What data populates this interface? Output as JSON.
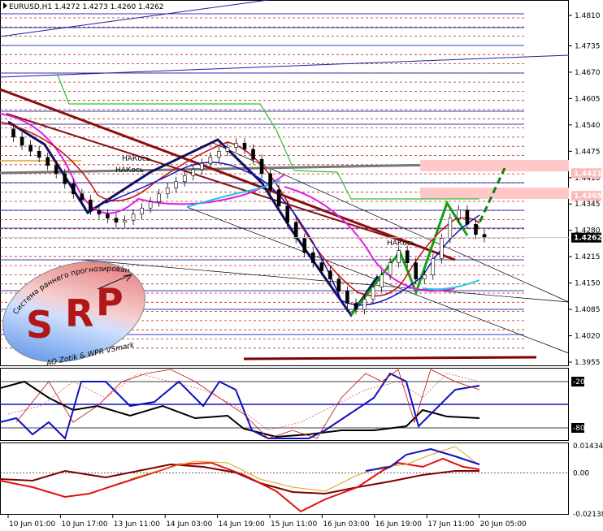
{
  "window": {
    "title": "EURUSD,H1  1.4272 1.4273 1.4260 1.4262"
  },
  "logo": {
    "arc_text": "Система раннего прогнозирования",
    "letters": [
      "S",
      "R",
      "P"
    ],
    "author": "AO Zotik & WPR VSmark"
  },
  "chart_data": [
    {
      "type": "line",
      "name": "price",
      "yticks": [
        "1.4810",
        "1.4735",
        "1.4670",
        "1.4605",
        "1.4540",
        "1.4475",
        "1.4410",
        "1.4345",
        "1.4280",
        "1.4215",
        "1.4150",
        "1.4085",
        "1.4020",
        "1.3955"
      ],
      "xticks": [
        "10 Jun 01:00",
        "10 Jun 17:00",
        "13 Jun 11:00",
        "14 Jun 03:00",
        "14 Jun 19:00",
        "15 Jun 11:00",
        "16 Jun 03:00",
        "16 Jun 19:00",
        "17 Jun 11:00",
        "20 Jun 05:00"
      ],
      "ylim": [
        1.3955,
        1.481
      ],
      "price_labels": [
        {
          "value": "1.4421",
          "color": "#ffb8b8"
        },
        {
          "value": "1.4365",
          "color": "#ffb8b8"
        },
        {
          "value": "1.4262",
          "color": "#000000"
        }
      ],
      "annotations": [
        "НАКось",
        "НАКось",
        "НАКось"
      ],
      "close": [
        1.453,
        1.451,
        1.449,
        1.4475,
        1.446,
        1.444,
        1.442,
        1.4395,
        1.437,
        1.4355,
        1.433,
        1.432,
        1.431,
        1.43,
        1.4305,
        1.432,
        1.4335,
        1.435,
        1.437,
        1.4385,
        1.44,
        1.4415,
        1.443,
        1.4445,
        1.446,
        1.4475,
        1.4485,
        1.4495,
        1.448,
        1.4455,
        1.442,
        1.438,
        1.434,
        1.43,
        1.426,
        1.4225,
        1.42,
        1.418,
        1.416,
        1.413,
        1.41,
        1.4085,
        1.411,
        1.414,
        1.417,
        1.42,
        1.423,
        1.42,
        1.416,
        1.417,
        1.421,
        1.426,
        1.431,
        1.433,
        1.4295,
        1.427,
        1.4262
      ]
    },
    {
      "type": "line",
      "name": "oscillator-1",
      "levels": [
        "-20",
        "-80"
      ],
      "ylim": [
        -100,
        0
      ]
    },
    {
      "type": "line",
      "name": "oscillator-2",
      "yticks": [
        "0.01434",
        "0.00",
        "-0.02138"
      ],
      "ylim": [
        -0.02138,
        0.01434
      ]
    }
  ]
}
